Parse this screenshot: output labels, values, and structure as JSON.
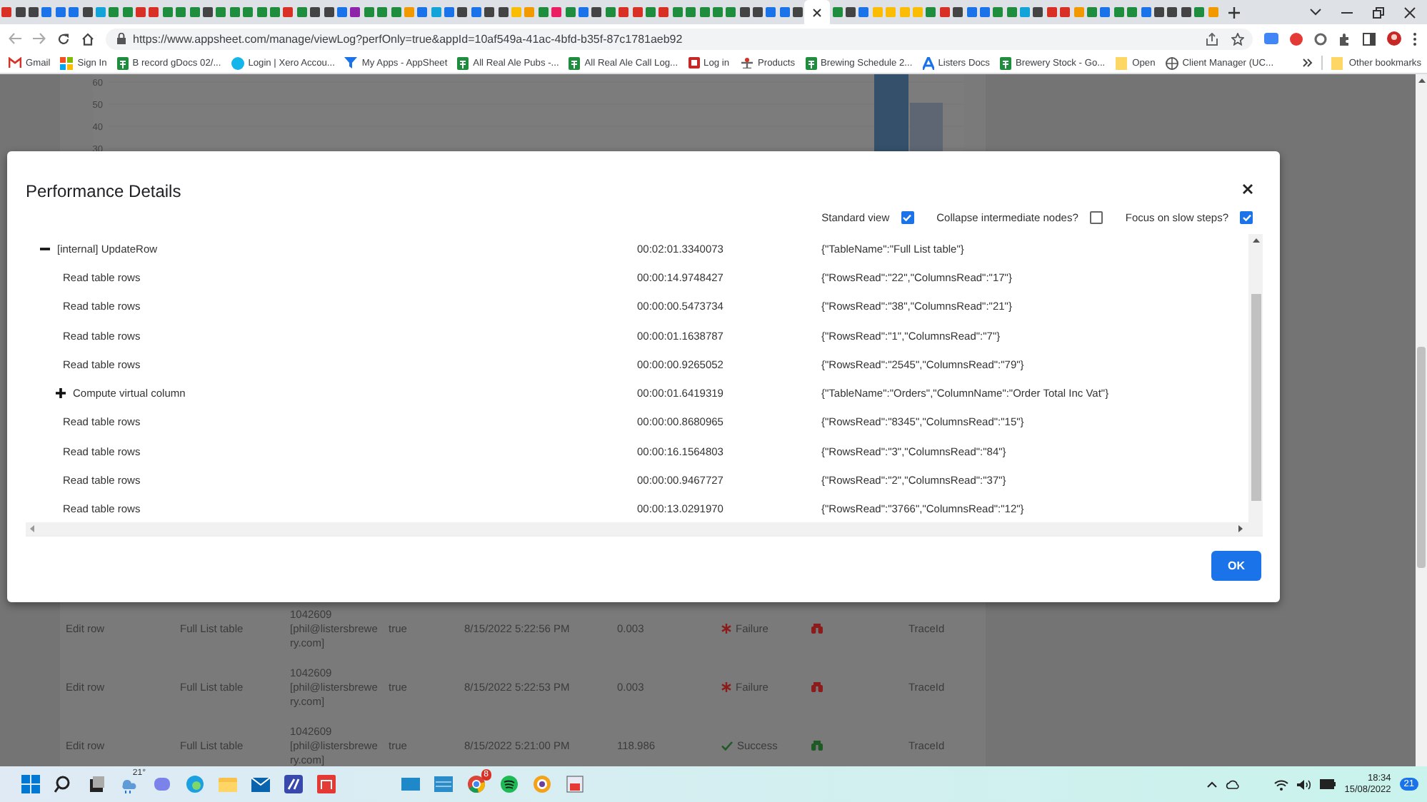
{
  "browser": {
    "tabs": [
      {
        "selected": false
      },
      {
        "selected": false
      },
      {
        "selected": false
      },
      {
        "selected": false
      },
      {
        "selected": false
      },
      {
        "selected": false
      },
      {
        "selected": false
      },
      {
        "selected": false
      },
      {
        "selected": false
      },
      {
        "selected": false
      },
      {
        "selected": false
      },
      {
        "selected": false
      },
      {
        "selected": false
      },
      {
        "selected": false
      },
      {
        "selected": false
      },
      {
        "selected": false
      },
      {
        "selected": false
      },
      {
        "selected": false
      },
      {
        "selected": false
      },
      {
        "selected": false
      },
      {
        "selected": false
      },
      {
        "selected": false
      },
      {
        "selected": false
      },
      {
        "selected": false
      },
      {
        "selected": false
      },
      {
        "selected": false
      },
      {
        "selected": false
      },
      {
        "selected": false
      },
      {
        "selected": false
      },
      {
        "selected": false
      },
      {
        "selected": false
      },
      {
        "selected": false
      },
      {
        "selected": false
      },
      {
        "selected": false
      },
      {
        "selected": false
      },
      {
        "selected": false
      },
      {
        "selected": false
      },
      {
        "selected": false
      },
      {
        "selected": false
      },
      {
        "selected": false
      },
      {
        "selected": false
      },
      {
        "selected": false
      },
      {
        "selected": false
      },
      {
        "selected": false
      },
      {
        "selected": false
      },
      {
        "selected": false
      },
      {
        "selected": false
      },
      {
        "selected": false
      },
      {
        "selected": false
      },
      {
        "selected": false
      },
      {
        "selected": false
      },
      {
        "selected": false
      },
      {
        "selected": false
      },
      {
        "selected": false
      },
      {
        "selected": false
      },
      {
        "selected": false
      },
      {
        "selected": false
      },
      {
        "selected": false
      },
      {
        "selected": false
      },
      {
        "selected": false
      },
      {
        "selected": true
      },
      {
        "selected": false
      },
      {
        "selected": false
      },
      {
        "selected": false
      },
      {
        "selected": false
      },
      {
        "selected": false
      },
      {
        "selected": false
      },
      {
        "selected": false
      },
      {
        "selected": false
      },
      {
        "selected": false
      },
      {
        "selected": false
      },
      {
        "selected": false
      },
      {
        "selected": false
      },
      {
        "selected": false
      },
      {
        "selected": false
      },
      {
        "selected": false
      },
      {
        "selected": false
      },
      {
        "selected": false
      },
      {
        "selected": false
      },
      {
        "selected": false
      },
      {
        "selected": false
      },
      {
        "selected": false
      },
      {
        "selected": false
      },
      {
        "selected": false
      },
      {
        "selected": false
      },
      {
        "selected": false
      },
      {
        "selected": false
      },
      {
        "selected": false
      },
      {
        "selected": false
      },
      {
        "selected": false
      }
    ],
    "url": "https://www.appsheet.com/manage/viewLog?perfOnly=true&appId=10af549a-41ac-4bfd-b35f-87c1781aeb92",
    "bookmarks": [
      {
        "label": "Gmail"
      },
      {
        "label": "Sign In"
      },
      {
        "label": "B record gDocs 02/..."
      },
      {
        "label": "Login | Xero Accou..."
      },
      {
        "label": "My Apps - AppSheet"
      },
      {
        "label": "All Real Ale Pubs -..."
      },
      {
        "label": "All Real Ale Call Log..."
      },
      {
        "label": "Log in"
      },
      {
        "label": "Products"
      },
      {
        "label": "Brewing Schedule 2..."
      },
      {
        "label": "Listers Docs"
      },
      {
        "label": "Brewery Stock - Go..."
      },
      {
        "label": "Open"
      },
      {
        "label": "Client Manager (UC..."
      }
    ],
    "other_bookmarks": "Other bookmarks"
  },
  "background": {
    "chart_ticks": [
      "60",
      "50",
      "40",
      "30"
    ],
    "rows": [
      {
        "action": "Edit row",
        "table": "Full List table",
        "user": "1042609\n[phil@listersbrewe\nry.com]",
        "column_4": "true",
        "time": "8/15/2022 5:22:56 PM",
        "duration": "0.003",
        "status": "Failure",
        "kind": "failure",
        "trace": "TraceId"
      },
      {
        "action": "Edit row",
        "table": "Full List table",
        "user": "1042609\n[phil@listersbrewe\nry.com]",
        "column_4": "true",
        "time": "8/15/2022 5:22:53 PM",
        "duration": "0.003",
        "status": "Failure",
        "kind": "failure",
        "trace": "TraceId"
      },
      {
        "action": "Edit row",
        "table": "Full List table",
        "user": "1042609\n[phil@listersbrewe\nry.com]",
        "column_4": "true",
        "time": "8/15/2022 5:21:00 PM",
        "duration": "118.986",
        "status": "Success",
        "kind": "success",
        "trace": "TraceId"
      }
    ]
  },
  "dialog": {
    "title": "Performance Details",
    "options": [
      {
        "label": "Standard view",
        "checked": true
      },
      {
        "label": "Collapse intermediate nodes?",
        "checked": false
      },
      {
        "label": "Focus on slow steps?",
        "checked": true
      }
    ],
    "tree": [
      {
        "kind": "group",
        "name": "[internal] UpdateRow",
        "time": "00:02:01.3340073",
        "detail": "{\"TableName\":\"Full List table\"}",
        "expanded": true,
        "children": [
          {
            "kind": "step",
            "name": "Read table rows",
            "time": "00:00:14.9748427",
            "detail": "{\"RowsRead\":\"22\",\"ColumnsRead\":\"17\"}"
          },
          {
            "kind": "step",
            "name": "Read table rows",
            "time": "00:00:00.5473734",
            "detail": "{\"RowsRead\":\"38\",\"ColumnsRead\":\"21\"}"
          },
          {
            "kind": "step",
            "name": "Read table rows",
            "time": "00:00:01.1638787",
            "detail": "{\"RowsRead\":\"1\",\"ColumnsRead\":\"7\"}"
          },
          {
            "kind": "step",
            "name": "Read table rows",
            "time": "00:00:00.9265052",
            "detail": "{\"RowsRead\":\"2545\",\"ColumnsRead\":\"79\"}"
          },
          {
            "kind": "group",
            "name": "Compute virtual column",
            "time": "00:00:01.6419319",
            "detail": "{\"TableName\":\"Orders\",\"ColumnName\":\"Order Total Inc Vat\"}",
            "expanded": false
          },
          {
            "kind": "step",
            "name": "Read table rows",
            "time": "00:00:00.8680965",
            "detail": "{\"RowsRead\":\"8345\",\"ColumnsRead\":\"15\"}"
          },
          {
            "kind": "step",
            "name": "Read table rows",
            "time": "00:00:16.1564803",
            "detail": "{\"RowsRead\":\"3\",\"ColumnsRead\":\"84\"}"
          },
          {
            "kind": "step",
            "name": "Read table rows",
            "time": "00:00:00.9467727",
            "detail": "{\"RowsRead\":\"2\",\"ColumnsRead\":\"37\"}"
          },
          {
            "kind": "step",
            "name": "Read table rows",
            "time": "00:00:13.0291970",
            "detail": "{\"RowsRead\":\"3766\",\"ColumnsRead\":\"12\"}"
          }
        ]
      }
    ],
    "ok_button": "OK"
  },
  "taskbar": {
    "weather": "21°",
    "browser_badge": "8",
    "time": "18:34",
    "date": "15/08/2022",
    "notifications": "21"
  }
}
